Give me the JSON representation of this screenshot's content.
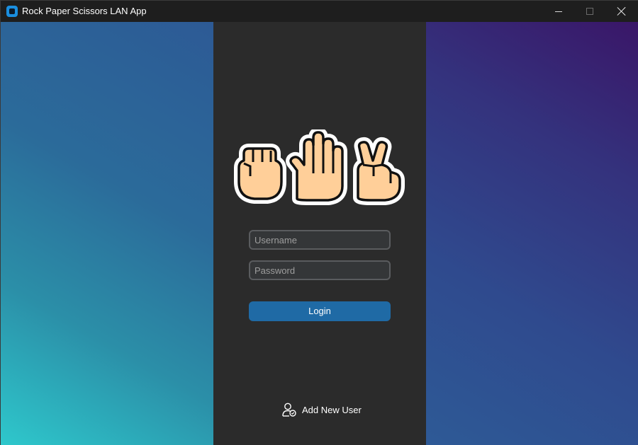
{
  "window": {
    "title": "Rock Paper Scissors LAN App",
    "controls": [
      "minimize",
      "maximize",
      "close"
    ]
  },
  "colors": {
    "panel_bg": "#2b2b2b",
    "accent": "#1f6aa5",
    "gradient_left": [
      "#2ec8cc",
      "#2d5a95"
    ],
    "gradient_right": [
      "#3a1668",
      "#2e5a96"
    ]
  },
  "login": {
    "username_placeholder": "Username",
    "username_value": "",
    "password_placeholder": "Password",
    "password_value": "",
    "login_label": "Login"
  },
  "footer": {
    "add_user_label": "Add New User",
    "add_user_icon": "add-user-icon"
  },
  "logo": {
    "icons": [
      "rock-hand-icon",
      "paper-hand-icon",
      "scissors-hand-icon"
    ]
  }
}
